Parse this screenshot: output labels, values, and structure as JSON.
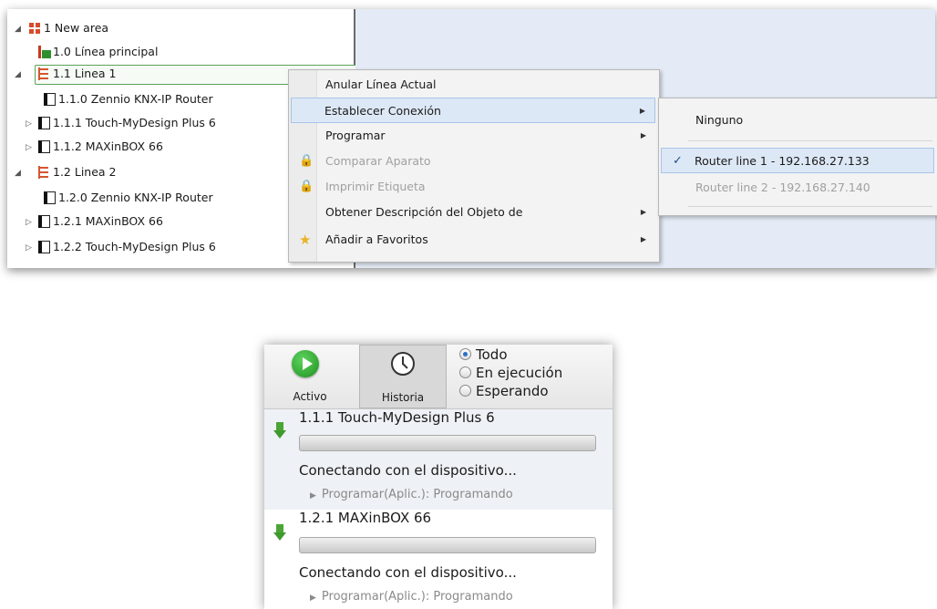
{
  "tree": {
    "items": [
      {
        "label": "1 New area",
        "icon": "area-icon",
        "expander": "expanded"
      },
      {
        "label": "1.0 Línea principal",
        "icon": "main-line-icon",
        "expander": ""
      },
      {
        "label": "1.1 Linea 1",
        "icon": "line-icon",
        "expander": "expanded"
      },
      {
        "label": "1.1.0  Zennio KNX-IP Router",
        "icon": "device-icon",
        "expander": ""
      },
      {
        "label": "1.1.1  Touch-MyDesign Plus 6",
        "icon": "device-icon",
        "expander": "collapsed"
      },
      {
        "label": "1.1.2  MAXinBOX 66",
        "icon": "device-icon",
        "expander": "collapsed"
      },
      {
        "label": "1.2 Linea 2",
        "icon": "line-icon",
        "expander": "expanded"
      },
      {
        "label": "1.2.0  Zennio KNX-IP Router",
        "icon": "device-icon",
        "expander": ""
      },
      {
        "label": "1.2.1  MAXinBOX 66",
        "icon": "device-icon",
        "expander": "collapsed"
      },
      {
        "label": "1.2.2  Touch-MyDesign Plus 6",
        "icon": "device-icon",
        "expander": "collapsed"
      }
    ],
    "expanded_glyph": "◢",
    "collapsed_glyph": "▷"
  },
  "context_menu": {
    "items": [
      {
        "label": "Anular Línea Actual",
        "state": "normal",
        "submenu": false
      },
      {
        "label": "Establecer Conexión",
        "state": "highlighted",
        "submenu": true
      },
      {
        "label": "Programar",
        "state": "normal",
        "submenu": true
      },
      {
        "label": "Comparar Aparato",
        "state": "disabled",
        "submenu": false,
        "icon": "lock-icon"
      },
      {
        "label": "Imprimir Etiqueta",
        "state": "disabled",
        "submenu": false,
        "icon": "lock-icon"
      },
      {
        "label": "Obtener Descripción del Objeto de",
        "state": "normal",
        "submenu": true
      },
      {
        "label": "Añadir a Favoritos",
        "state": "normal",
        "submenu": true,
        "icon": "star-icon"
      }
    ],
    "arrow_glyph": "▶",
    "lock_glyph": "🔒",
    "star_glyph": "★"
  },
  "submenu": {
    "items": [
      {
        "label": "Ninguno",
        "checked": false,
        "state": "normal"
      },
      {
        "label": "Router line 1 - 192.168.27.133",
        "checked": true,
        "state": "highlighted"
      },
      {
        "label": "Router line 2 - 192.168.27.140",
        "checked": false,
        "state": "disabled"
      }
    ],
    "check_glyph": "✓"
  },
  "progress_panel": {
    "tabs": [
      {
        "label": "Activo",
        "icon": "play-icon",
        "selected": false
      },
      {
        "label": "Historia",
        "icon": "clock-icon",
        "selected": true
      }
    ],
    "filters": [
      {
        "label": "Todo",
        "selected": true
      },
      {
        "label": "En ejecución",
        "selected": false
      },
      {
        "label": "Esperando",
        "selected": false
      }
    ],
    "jobs": [
      {
        "title": "1.1.1 Touch-MyDesign Plus 6",
        "progress": 0,
        "status": "Conectando con el dispositivo...",
        "detail": "Programar(Aplic.): Programando"
      },
      {
        "title": "1.2.1 MAXinBOX 66",
        "progress": 0,
        "status": "Conectando con el dispositivo...",
        "detail": "Programar(Aplic.): Programando"
      }
    ],
    "detail_glyph": "▶"
  },
  "colors": {
    "highlight": "#dde8f6",
    "selection_border": "#5aa35a",
    "line_icon": "#d6552f",
    "progress_green": "#56b045"
  }
}
